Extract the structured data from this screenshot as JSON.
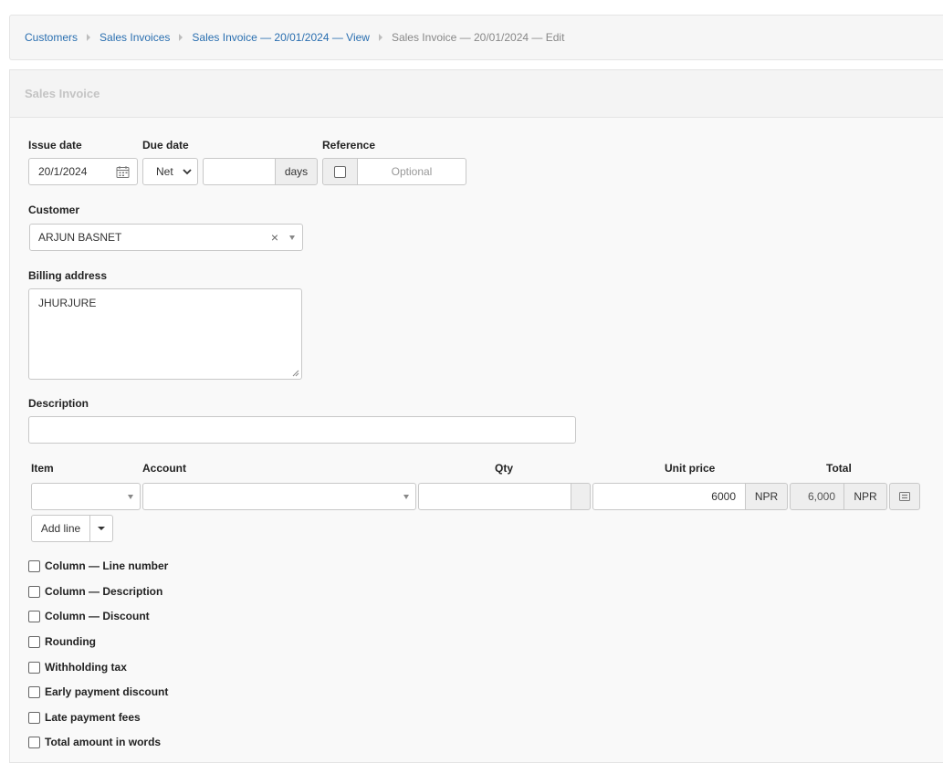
{
  "breadcrumb": {
    "items": [
      "Customers",
      "Sales Invoices",
      "Sales Invoice — 20/01/2024 — View"
    ],
    "current": "Sales Invoice — 20/01/2024 — Edit"
  },
  "panel": {
    "title": "Sales Invoice"
  },
  "form": {
    "issue_date": {
      "label": "Issue date",
      "value": "20/1/2024"
    },
    "due_date": {
      "label": "Due date",
      "select_value": "Net",
      "days_value": "",
      "days_label": "days"
    },
    "reference": {
      "label": "Reference",
      "placeholder": "Optional"
    },
    "customer": {
      "label": "Customer",
      "value": "ARJUN BASNET",
      "clear": "×"
    },
    "billing_address": {
      "label": "Billing address",
      "value": "JHURJURE"
    },
    "description": {
      "label": "Description",
      "value": ""
    }
  },
  "lines": {
    "headers": {
      "item": "Item",
      "account": "Account",
      "qty": "Qty",
      "unit_price": "Unit price",
      "total": "Total"
    },
    "row": {
      "item": "",
      "account": "",
      "qty": "",
      "unit_price": "6000",
      "currency": "NPR",
      "total": "6,000",
      "total_currency": "NPR"
    },
    "add_line": "Add line"
  },
  "options": [
    "Column — Line number",
    "Column — Description",
    "Column — Discount",
    "Rounding",
    "Withholding tax",
    "Early payment discount",
    "Late payment fees",
    "Total amount in words"
  ]
}
